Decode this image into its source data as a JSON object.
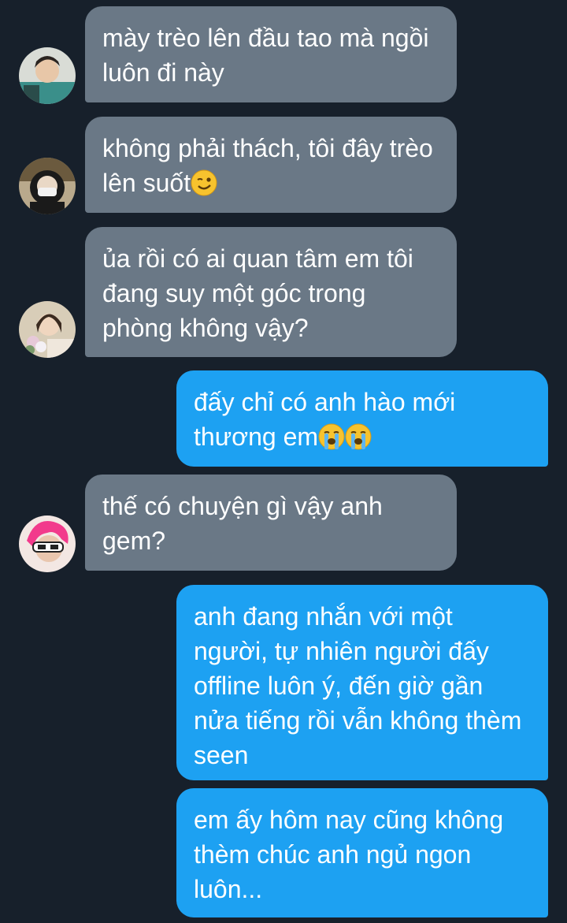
{
  "messages": [
    {
      "side": "incoming",
      "text": "mày trèo lên đầu tao mà ngồi luôn đi này",
      "emoji": [],
      "avatar": "avatar-teal-shirt"
    },
    {
      "side": "incoming",
      "text": "không phải thách, tôi đây trèo lên suốt",
      "emoji": [
        "winking-face"
      ],
      "avatar": "avatar-masked-girl"
    },
    {
      "side": "incoming",
      "text": "ủa rồi có ai quan tâm em tôi đang suy một góc trong phòng không vậy?",
      "emoji": [],
      "avatar": "avatar-flowers-girl"
    },
    {
      "side": "outgoing",
      "text": "đấy chỉ có anh hào mới thương em",
      "emoji": [
        "loudly-crying-face",
        "loudly-crying-face"
      ]
    },
    {
      "side": "incoming",
      "text": "thế có chuyện gì vậy anh gem?",
      "emoji": [],
      "avatar": "avatar-pink-hair"
    },
    {
      "side": "outgoing",
      "text": "anh đang nhắn với một người, tự nhiên người đấy offline luôn ý, đến giờ gần nửa tiếng rồi vẫn không thèm seen",
      "emoji": []
    },
    {
      "side": "outgoing",
      "text": "em ấy hôm nay cũng không thèm chúc anh ngủ ngon luôn...",
      "emoji": []
    }
  ],
  "colors": {
    "background": "#17202b",
    "incoming_bubble": "#6a7886",
    "outgoing_bubble": "#1da1f2",
    "text": "#ffffff"
  }
}
